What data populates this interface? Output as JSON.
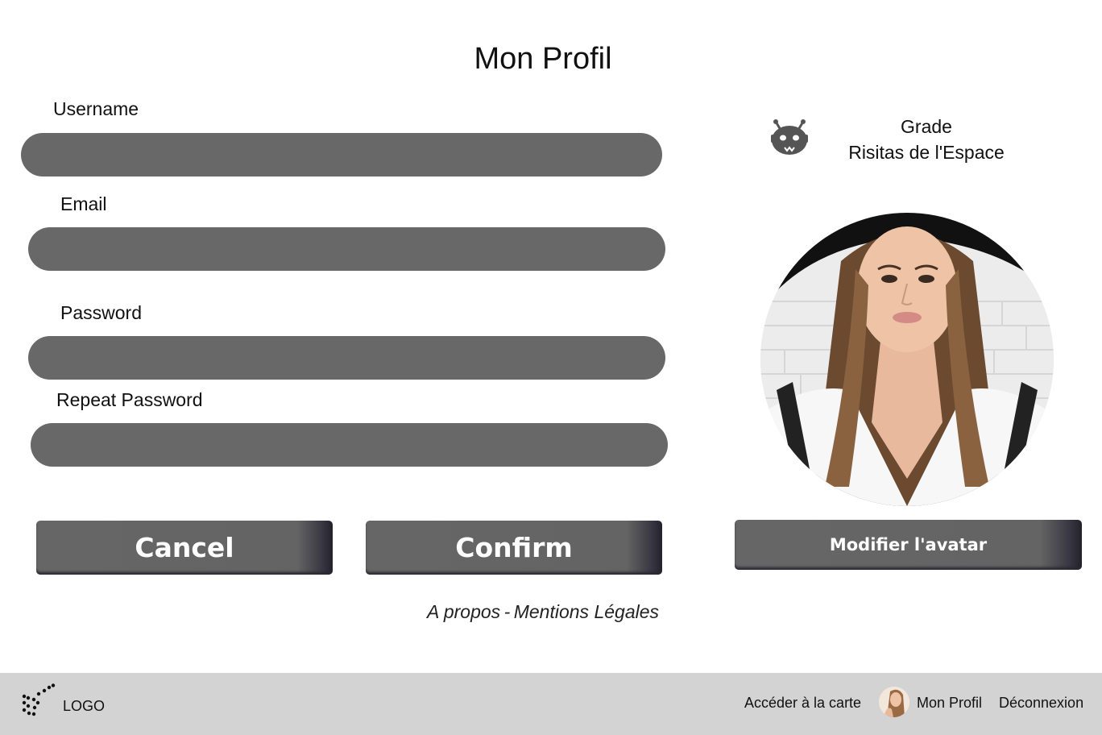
{
  "page": {
    "title": "Mon Profil"
  },
  "form": {
    "username_label": "Username",
    "username_value": "",
    "email_label": "Email",
    "email_value": "",
    "password_label": "Password",
    "password_value": "",
    "repeat_password_label": "Repeat Password",
    "repeat_password_value": ""
  },
  "actions": {
    "cancel_label": "Cancel",
    "confirm_label": "Confirm",
    "modify_avatar_label": "Modifier l'avatar"
  },
  "grade": {
    "heading": "Grade",
    "value": "Risitas de l'Espace",
    "icon": "alien-icon"
  },
  "footer": {
    "about_label": "A propos",
    "separator": "-",
    "legal_label": "Mentions Légales"
  },
  "navbar": {
    "logo_text": "LOGO",
    "map_label": "Accéder à la carte",
    "profile_label": "Mon Profil",
    "logout_label": "Déconnexion"
  },
  "colors": {
    "field_bg": "#686868",
    "button_bg": "#666666",
    "navbar_bg": "#d3d3d3"
  }
}
